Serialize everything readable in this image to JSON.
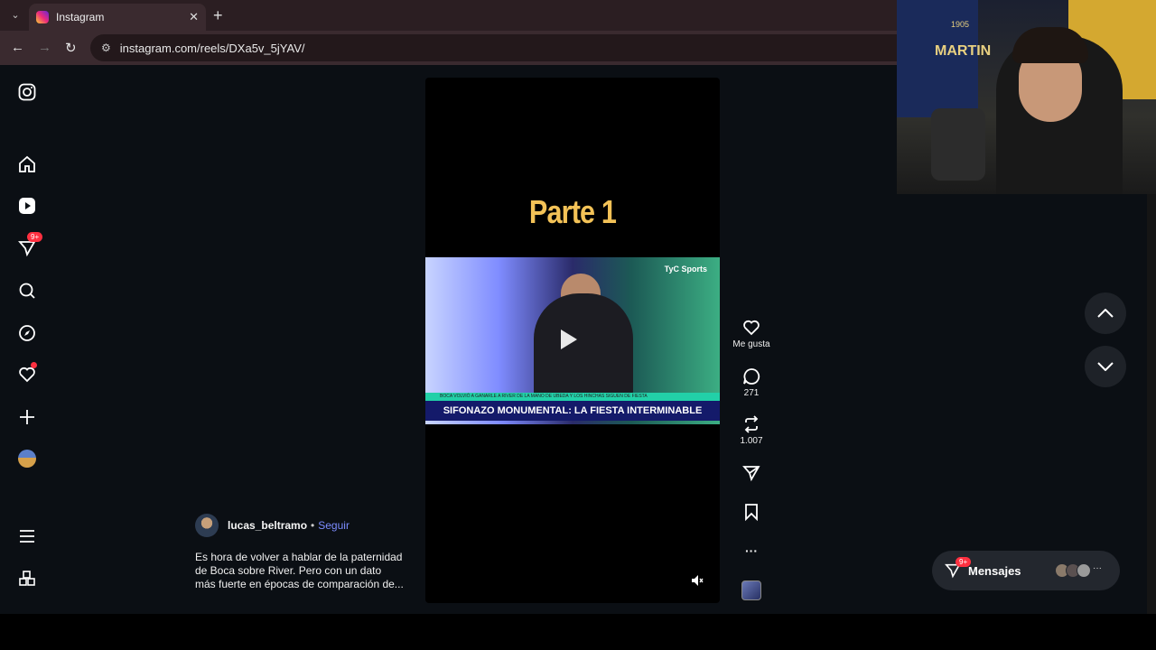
{
  "browser": {
    "tab_title": "Instagram",
    "tab_close": "✕",
    "new_tab": "+",
    "url": "instagram.com/reels/DXa5v_5jYAV/"
  },
  "nav": {
    "notifications_badge": "9+"
  },
  "reel": {
    "overlay_title": "Parte 1",
    "channel_logo": "TyC Sports",
    "ticker_text": "BOCA VOLVIÓ A GANARLE A RIVER DE LA MANO DE UBEDA Y LOS HINCHAS SIGUEN DE FIESTA",
    "headline": "SIFONAZO MONUMENTAL: LA FIESTA INTERMINABLE"
  },
  "actions": {
    "like_label": "Me gusta",
    "comments_count": "271",
    "reposts_count": "1.007",
    "more_label": "···"
  },
  "author": {
    "username": "lucas_beltramo",
    "separator": "•",
    "follow_label": "Seguir",
    "caption": "Es hora de volver a hablar de la paternidad de Boca sobre River. Pero con un dato más fuerte en épocas de comparación de..."
  },
  "messages": {
    "label": "Mensajes",
    "badge": "9+",
    "more": "···"
  },
  "webcam": {
    "jersey_name": "MARTIN",
    "jersey_year": "1905"
  },
  "colors": {
    "accent_follow": "#7c8cff",
    "badge_red": "#ff3040",
    "reel_title": "#f3c257"
  }
}
